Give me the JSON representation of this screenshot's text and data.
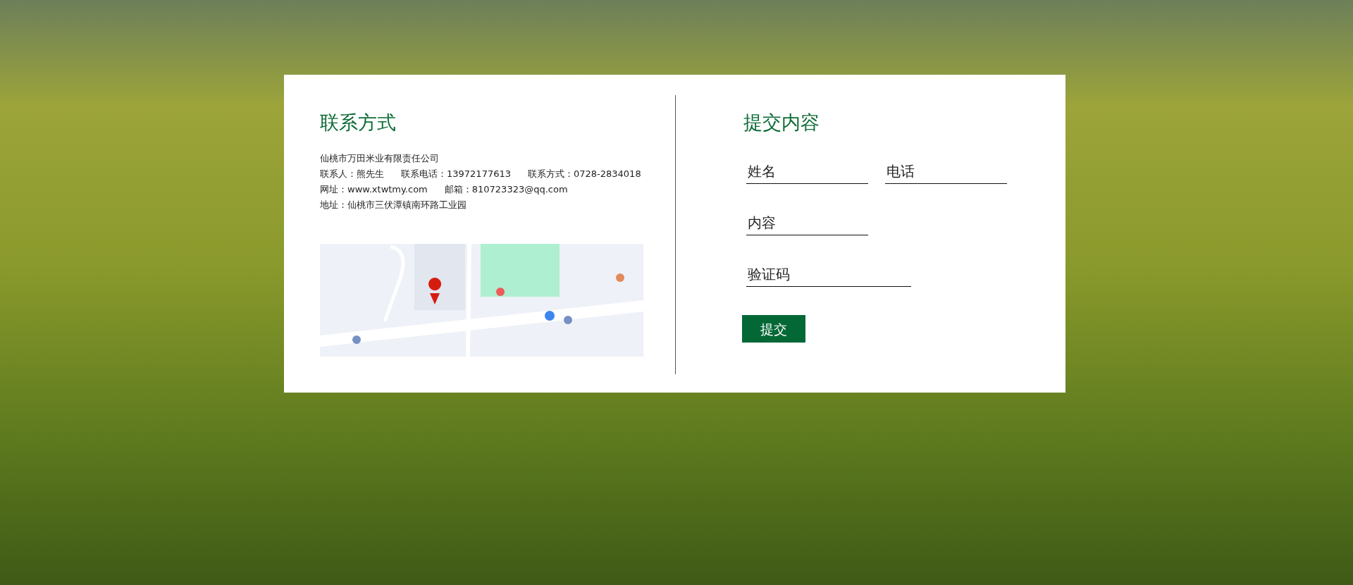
{
  "contact": {
    "title": "联系方式",
    "lines": [
      [
        "仙桃市万田米业有限责任公司"
      ],
      [
        "联系人：熊先生",
        "联系电话：13972177613",
        "联系方式：0728-2834018"
      ],
      [
        "网址：www.xtwtmy.com",
        "邮箱：810723323@qq.com"
      ],
      [
        "地址：仙桃市三伏潭镇南环路工业园"
      ]
    ]
  },
  "form": {
    "title": "提交内容",
    "rows": [
      [
        {
          "placeholder": "姓名"
        },
        {
          "placeholder": "电话"
        }
      ],
      [
        {
          "placeholder": "内容"
        }
      ],
      [
        {
          "placeholder": "验证码"
        }
      ]
    ],
    "submit": "提交"
  }
}
